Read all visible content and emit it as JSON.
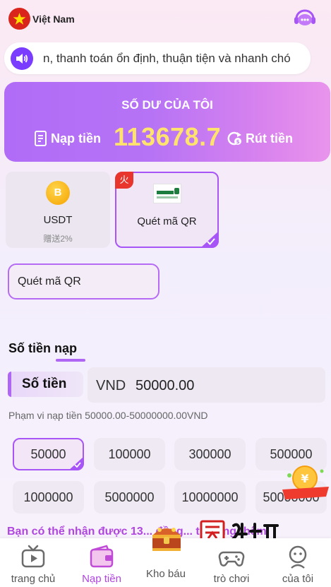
{
  "header": {
    "country": "Việt Nam",
    "flag_icon": "vietnam-flag-icon",
    "support_icon": "customer-service-icon"
  },
  "marquee": {
    "text": "n, thanh toán ổn định, thuận tiện và nhanh chó"
  },
  "balance": {
    "title": "SỐ DƯ CỦA TÔI",
    "amount": "113678.7",
    "deposit_label": "Nạp tiền",
    "withdraw_label": "Rút tiền"
  },
  "methods": [
    {
      "label": "USDT",
      "sub": "赠送2%",
      "icon": "bitcoin-coin-icon"
    },
    {
      "label": "Quét mã QR",
      "badge": "火",
      "icon": "bank-logo-icon",
      "selected": true
    }
  ],
  "sub_method": {
    "label": "Quét mã QR"
  },
  "amount_section": {
    "title": "Số tiền nạp",
    "label": "Số tiền",
    "currency": "VND",
    "value": "50000.00",
    "range": "Phạm vi nạp tiền 50000.00-50000000.00VND"
  },
  "presets": [
    "50000",
    "100000",
    "300000",
    "500000",
    "1000000",
    "5000000",
    "10000000",
    "50000000"
  ],
  "bonus_text": "Bạn có thể nhận được 13... đồng... thưởng thêm",
  "tabs": [
    {
      "label": "trang chủ",
      "icon": "tv-icon"
    },
    {
      "label": "Nạp tiền",
      "icon": "wallet-icon",
      "active": true
    },
    {
      "label": "Kho báu",
      "icon": "treasure-chest-icon"
    },
    {
      "label": "trò chơi",
      "icon": "gamepad-icon"
    },
    {
      "label": "của tôi",
      "icon": "profile-icon"
    }
  ],
  "colors": {
    "accent": "#a855f7",
    "balance_amount": "#ffe36c",
    "bonus_text": "#b045e0"
  }
}
